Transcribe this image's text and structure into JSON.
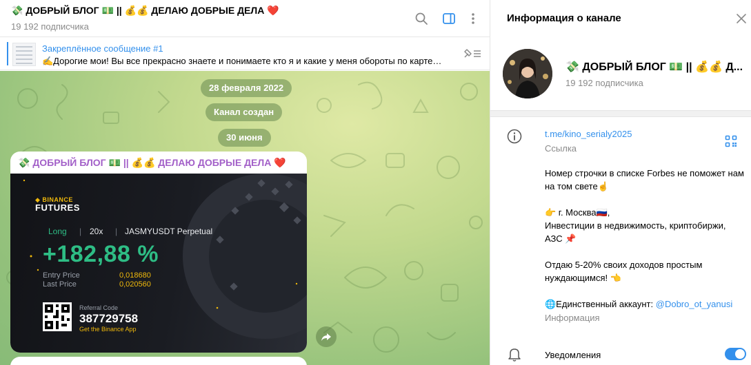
{
  "chat": {
    "title": "💸 ДОБРЫЙ БЛОГ 💵 || 💰💰 ДЕЛАЮ ДОБРЫЕ ДЕЛА ❤️",
    "subscribers": "19 192 подписчика",
    "header_icons": [
      "search-icon",
      "sidebar-toggle-icon",
      "more-vertical-icon"
    ],
    "pinned": {
      "title": "Закреплённое сообщение #1",
      "text": "✍️Дорогие мои! Вы все прекрасно знаете и понимаете кто я и какие у меня обороты по карте…"
    },
    "service_messages": [
      "28 февраля 2022",
      "Канал создан",
      "30 июня"
    ],
    "post": {
      "author_main": "💸 ДОБРЫЙ БЛОГ 💵 || 💰💰 ДЕЛАЮ ДОБРЫЕ ДЕЛА ",
      "author_heart": "❤️",
      "card": {
        "logo_top": "◆ BINANCE",
        "logo_bottom": "FUTURES",
        "side": "Long",
        "separator": "|",
        "leverage": "20x",
        "pair": "JASMYUSDT Perpetual",
        "pnl": "+182,88 %",
        "entry_label": "Entry Price",
        "entry_value": "0,018680",
        "last_label": "Last Price",
        "last_value": "0,020560",
        "referral_label": "Referral Code",
        "referral_code": "387729758",
        "app_text": "Get the Binance App"
      }
    }
  },
  "info": {
    "title": "Информация о канале",
    "name": "💸 ДОБРЫЙ БЛОГ 💵 || 💰💰 Д...",
    "subscribers": "19 192 подписчика",
    "link": "t.me/kino_serialy2025",
    "link_label": "Ссылка",
    "desc_lines": [
      "Номер строчки в списке Forbes не поможет нам на том свете☝️",
      "👉 г. Москва🇷🇺,",
      "Инвестиции в недвижимость, криптобиржи, АЗС 📌",
      "Отдаю 5-20% своих доходов простым нуждающимся! 👈"
    ],
    "account_prefix": "🌐Единственный аккаунт: ",
    "account_link": "@Dobro_ot_yanusi",
    "desc_label": "Информация",
    "notifications": "Уведомления",
    "notifications_on": true
  },
  "colors": {
    "accent": "#3390ec",
    "author": "#a25fc8",
    "profit_green": "#2ebd85",
    "binance_yellow": "#f0b90b"
  }
}
